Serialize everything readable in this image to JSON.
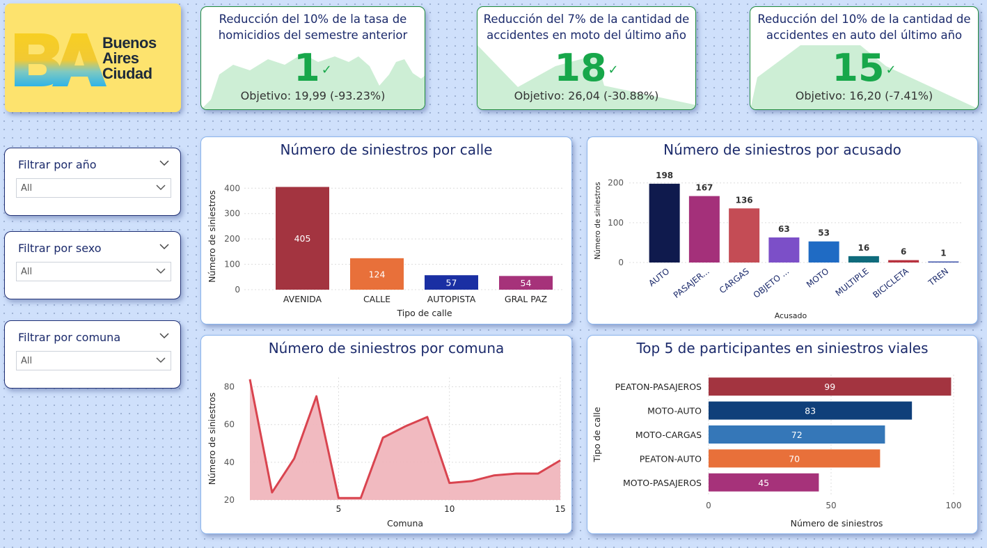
{
  "logo": {
    "line1": "Buenos",
    "line2": "Aires",
    "line3": "Ciudad",
    "mark": "BA"
  },
  "filters": [
    {
      "title": "Filtrar por año",
      "value": "All"
    },
    {
      "title": "Filtrar por sexo",
      "value": "All"
    },
    {
      "title": "Filtrar por comuna",
      "value": "All"
    }
  ],
  "kpis": [
    {
      "title_line1": "Reducción del 10% de la tasa de",
      "title_line2": "homicidios del semestre anterior",
      "value": "1",
      "goal": "Objetivo: 19,99 (-93.23%)",
      "check_icon": "check-icon"
    },
    {
      "title_line1": "Reducción del 7% de la cantidad de",
      "title_line2": "accidentes en moto del último año",
      "value": "18",
      "goal": "Objetivo: 26,04 (-30.88%)",
      "check_icon": "check-icon"
    },
    {
      "title_line1": "Reducción del 10% de la cantidad de",
      "title_line2": "accidentes en auto del último año",
      "value": "15",
      "goal": "Objetivo: 16,20 (-7.41%)",
      "check_icon": "check-icon"
    }
  ],
  "colors": {
    "kpi_green": "#17a74a",
    "spark_fill": "#cdeed5",
    "title_navy": "#1b2a6b"
  },
  "chart_data": [
    {
      "id": "calle",
      "type": "bar",
      "title": "Número de siniestros por calle",
      "xlabel": "Tipo de calle",
      "ylabel": "Número de siniestros",
      "categories": [
        "AVENIDA",
        "CALLE",
        "AUTOPISTA",
        "GRAL PAZ"
      ],
      "values": [
        405,
        124,
        57,
        54
      ],
      "colors": [
        "#a33440",
        "#e8703a",
        "#1a2fa3",
        "#a6327a"
      ],
      "ylim": [
        0,
        420
      ],
      "yticks": [
        0,
        100,
        200,
        300,
        400
      ],
      "grid": true
    },
    {
      "id": "acusado",
      "type": "bar",
      "title": "Número de siniestros por acusado",
      "xlabel": "Acusado",
      "ylabel": "Número de siniestros",
      "categories": [
        "AUTO",
        "PASAJER...",
        "CARGAS",
        "OBJETO ...",
        "MOTO",
        "MULTIPLE",
        "BICICLETA",
        "TREN"
      ],
      "values": [
        198,
        167,
        136,
        63,
        53,
        16,
        6,
        1
      ],
      "colors": [
        "#0f1a4d",
        "#a4307a",
        "#c44c55",
        "#7c4fc8",
        "#1f6bc4",
        "#0f6b7c",
        "#b8323e",
        "#3a4fa8"
      ],
      "ylim": [
        0,
        210
      ],
      "yticks": [
        0,
        100,
        200
      ],
      "grid": true
    },
    {
      "id": "comuna",
      "type": "area",
      "title": "Número de siniestros por comuna",
      "xlabel": "Comuna",
      "ylabel": "Número de siniestros",
      "x": [
        1,
        2,
        3,
        4,
        5,
        6,
        7,
        8,
        9,
        10,
        11,
        12,
        13,
        14,
        15
      ],
      "values": [
        84,
        24,
        42,
        75,
        21,
        21,
        53,
        59,
        64,
        29,
        30,
        33,
        34,
        34,
        41
      ],
      "xlim": [
        1,
        15
      ],
      "ylim": [
        20,
        85
      ],
      "xticks": [
        5,
        10,
        15
      ],
      "yticks": [
        20,
        40,
        60,
        80
      ],
      "color": "#d9444f",
      "fill": "#f0b3b9",
      "grid": true
    },
    {
      "id": "participantes",
      "type": "bar",
      "orientation": "horizontal",
      "title": "Top 5 de participantes en siniestros viales",
      "xlabel": "Número de siniestros",
      "ylabel": "Tipo de calle",
      "categories": [
        "PEATON-PASAJEROS",
        "MOTO-AUTO",
        "MOTO-CARGAS",
        "PEATON-AUTO",
        "MOTO-PASAJEROS"
      ],
      "values": [
        99,
        83,
        72,
        70,
        45
      ],
      "colors": [
        "#a33440",
        "#0f3f7a",
        "#3577b8",
        "#e8703a",
        "#a6327a"
      ],
      "xlim": [
        0,
        100
      ],
      "xticks": [
        0,
        50,
        100
      ],
      "grid": true
    }
  ]
}
